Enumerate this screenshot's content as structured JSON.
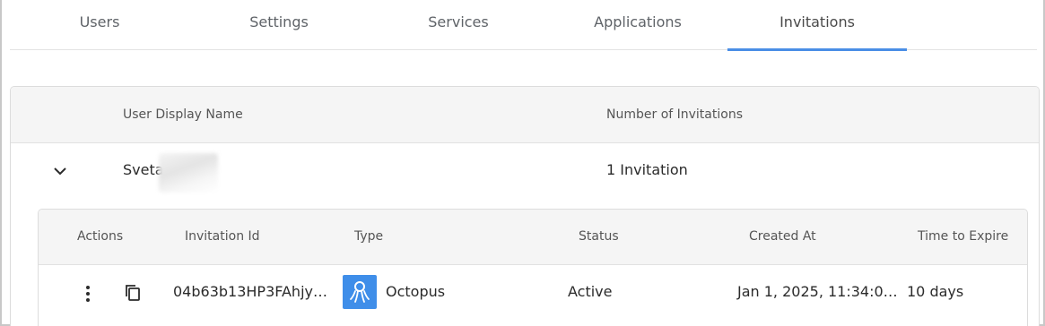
{
  "tabs": [
    {
      "label": "Users"
    },
    {
      "label": "Settings"
    },
    {
      "label": "Services"
    },
    {
      "label": "Applications"
    },
    {
      "label": "Invitations",
      "active": true
    }
  ],
  "users_table": {
    "headers": {
      "user_display_name": "User Display Name",
      "number_of_invitations": "Number of Invitations"
    },
    "rows": [
      {
        "display_name": "Sveta",
        "invitations": "1 Invitation",
        "expanded": true
      }
    ]
  },
  "invitations_table": {
    "headers": {
      "actions": "Actions",
      "invitation_id": "Invitation Id",
      "type": "Type",
      "status": "Status",
      "created_at": "Created At",
      "time_to_expire": "Time to Expire"
    },
    "rows": [
      {
        "invitation_id": "04b63b13HP3FAhjy…",
        "type": "Octopus",
        "type_icon": "octopus-icon",
        "status": "Active",
        "created_at": "Jan 1, 2025, 11:34:0…",
        "time_to_expire": "10 days"
      }
    ]
  },
  "colors": {
    "accent": "#4a8ee6",
    "type_icon_bg": "#3f8ee9"
  }
}
